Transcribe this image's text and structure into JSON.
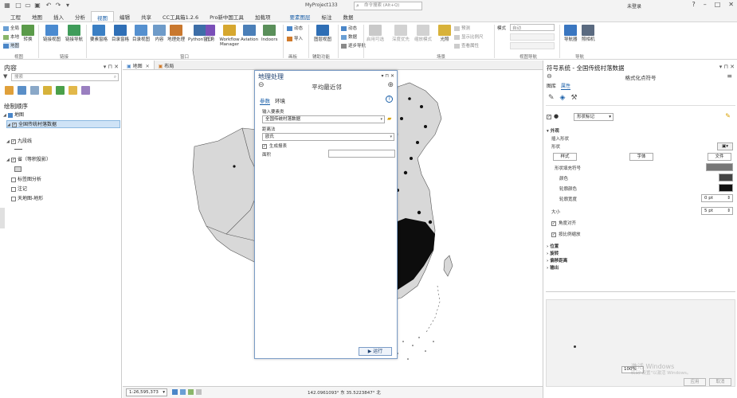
{
  "titlebar": {
    "project_title": "MyProject133",
    "search_placeholder": "命令搜索 (Alt+Q)",
    "user": "未登录",
    "quick_access": [
      "new-icon",
      "open-icon",
      "save-icon",
      "undo-icon",
      "redo-icon"
    ]
  },
  "ribbon_tabs": [
    "工程",
    "地图",
    "插入",
    "分析",
    "视图",
    "编辑",
    "共享",
    "CC工具箱1.2.6",
    "Pro新中国工具",
    "加载项",
    "要素图层",
    "标注",
    "数据"
  ],
  "ribbon": {
    "buttons": [
      "转换",
      "链接视图",
      "链接导航",
      "要素窗格",
      "目录窗格",
      "目录视图",
      "内容",
      "地理处理",
      "Python窗口",
      "Workflow Manager",
      "Aviation",
      "Indoors",
      "图层视图",
      "启用可选",
      "深度优先",
      "缩放模式",
      "光照",
      "导航器",
      "照相机"
    ],
    "small_items": [
      "全局",
      "本地",
      "地图",
      "导入",
      "动态",
      "数据",
      "逐步导航",
      "预测",
      "显示比例尺",
      "查看属性",
      "模式",
      "自动"
    ],
    "groups": [
      "视图",
      "链接",
      "窗口",
      "画板",
      "辅助功能",
      "场景",
      "视图导航",
      "导航"
    ],
    "mode_label": "模式",
    "mode_value": "自动"
  },
  "contents": {
    "title": "内容",
    "search_placeholder": "搜索",
    "draw_order": "绘制顺序",
    "map": "地图",
    "layers": [
      {
        "label": "全国传统村落数据",
        "checked": true,
        "selected": true
      },
      {
        "label": "九段线",
        "checked": true,
        "selected": false
      },
      {
        "label": "省（等积投影）",
        "checked": true,
        "selected": false
      },
      {
        "label": "标签图分析",
        "checked": false,
        "selected": false
      },
      {
        "label": "注记",
        "checked": false,
        "selected": false
      },
      {
        "label": "天地图-地形",
        "checked": false,
        "selected": false
      }
    ]
  },
  "map_tabs": [
    "地图",
    "布局"
  ],
  "status": {
    "scale": "1:26,595,373",
    "coords": "142.0961093° 东 35.5223847° 北"
  },
  "geo": {
    "title": "地理处理",
    "tool_title": "平均最近邻",
    "tabs": [
      "参数",
      "环境"
    ],
    "input_label": "输入要素类",
    "input_value": "全国传统村落数据",
    "distance_label": "距离法",
    "distance_value": "欧氏",
    "report_label": "生成报表",
    "area_label": "面积",
    "run_label": "运行"
  },
  "sym": {
    "title": "符号系统 - 全国传统村落数据",
    "subtitle": "格式化点符号",
    "tabs": [
      "图库",
      "属性"
    ],
    "shape_label": "形状标记",
    "appearance": "外观",
    "insert_shape": "插入形状",
    "shape": "形状",
    "style_btn": "样式",
    "font_btn": "字体",
    "file_btn": "文件",
    "shape_fill": "形状填充符号",
    "color": "颜色",
    "outline_color": "轮廓颜色",
    "outline_width": "轮廓宽度",
    "outline_width_value": "0 pt",
    "size": "大小",
    "size_value": "5 pt",
    "keep_aspect": "角度对齐",
    "scale_pattern": "按比例缩放",
    "sections": [
      "位置",
      "旋转",
      "偏移距离",
      "输出"
    ],
    "zoom_value": "100%",
    "watermark_line1": "激活 Windows",
    "watermark_line2": "转到\"设置\"以激活 Windows。",
    "apply": "应用",
    "cancel": "取消"
  }
}
